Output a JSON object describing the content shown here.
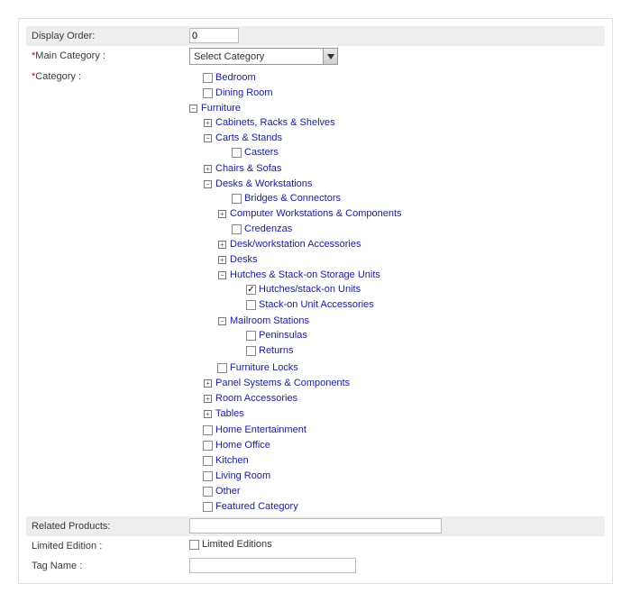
{
  "displayOrder": {
    "label": "Display Order:",
    "value": "0"
  },
  "mainCategory": {
    "label": "Main Category :",
    "selected": "Select Category"
  },
  "category": {
    "label": "Category :",
    "tree": [
      {
        "label": "Bedroom",
        "checkbox": true,
        "checked": false
      },
      {
        "label": "Dining Room",
        "checkbox": true,
        "checked": false
      },
      {
        "label": "Furniture",
        "checkbox": false,
        "expanded": true,
        "children": [
          {
            "label": "Cabinets, Racks & Shelves",
            "checkbox": false,
            "expandable": true
          },
          {
            "label": "Carts & Stands",
            "checkbox": false,
            "expanded": true,
            "children": [
              {
                "label": "Casters",
                "checkbox": true,
                "checked": false
              }
            ]
          },
          {
            "label": "Chairs & Sofas",
            "checkbox": false,
            "expandable": true
          },
          {
            "label": "Desks & Workstations",
            "checkbox": false,
            "expanded": true,
            "children": [
              {
                "label": "Bridges & Connectors",
                "checkbox": true,
                "checked": false
              },
              {
                "label": "Computer Workstations & Components",
                "checkbox": false,
                "expandable": true
              },
              {
                "label": "Credenzas",
                "checkbox": true,
                "checked": false
              },
              {
                "label": "Desk/workstation Accessories",
                "checkbox": false,
                "expandable": true
              },
              {
                "label": "Desks",
                "checkbox": false,
                "expandable": true
              },
              {
                "label": "Hutches & Stack-on Storage Units",
                "checkbox": false,
                "expanded": true,
                "children": [
                  {
                    "label": "Hutches/stack-on Units",
                    "checkbox": true,
                    "checked": true
                  },
                  {
                    "label": "Stack-on Unit Accessories",
                    "checkbox": true,
                    "checked": false
                  }
                ]
              },
              {
                "label": "Mailroom Stations",
                "checkbox": false,
                "expanded": true,
                "children": [
                  {
                    "label": "Peninsulas",
                    "checkbox": true,
                    "checked": false
                  },
                  {
                    "label": "Returns",
                    "checkbox": true,
                    "checked": false
                  }
                ]
              }
            ]
          },
          {
            "label": "Furniture Locks",
            "checkbox": true,
            "checked": false
          },
          {
            "label": "Panel Systems & Components",
            "checkbox": false,
            "expandable": true
          },
          {
            "label": "Room Accessories",
            "checkbox": false,
            "expandable": true
          },
          {
            "label": "Tables",
            "checkbox": false,
            "expandable": true
          }
        ]
      },
      {
        "label": "Home Entertainment",
        "checkbox": true,
        "checked": false
      },
      {
        "label": "Home Office",
        "checkbox": true,
        "checked": false
      },
      {
        "label": "Kitchen",
        "checkbox": true,
        "checked": false
      },
      {
        "label": "Living Room",
        "checkbox": true,
        "checked": false
      },
      {
        "label": "Other",
        "checkbox": true,
        "checked": false
      },
      {
        "label": "Featured Category",
        "checkbox": true,
        "checked": false
      }
    ]
  },
  "relatedProducts": {
    "label": "Related Products:",
    "value": ""
  },
  "limitedEdition": {
    "label": "Limited Edition :",
    "optionLabel": "Limited Editions",
    "checked": false
  },
  "tagName": {
    "label": "Tag Name :",
    "value": ""
  }
}
